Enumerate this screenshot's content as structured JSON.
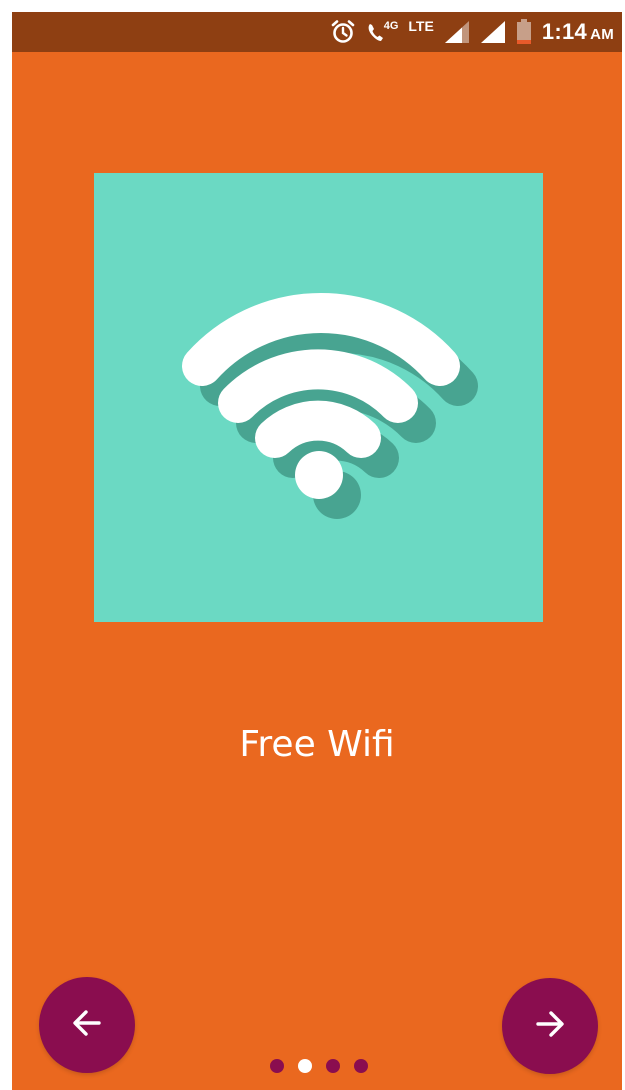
{
  "colors": {
    "status_bar": "#8E3F12",
    "background": "#EA681F",
    "card": "#6BD9C3",
    "wifi_icon": "#FFFFFF",
    "wifi_shadow": "#2D7A6A",
    "nav_button": "#8A0D4F",
    "dot_active": "#FFFFFF",
    "dot_inactive": "#8A0D4F"
  },
  "status_bar": {
    "time": "1:14",
    "ampm": "AM",
    "network": "LTE",
    "call_label": "4G",
    "icons": [
      "alarm-icon",
      "volte-call-icon",
      "signal-icon",
      "signal-icon",
      "battery-icon"
    ]
  },
  "slide": {
    "title": "Free Wifi",
    "image_icon": "wifi-icon"
  },
  "nav": {
    "prev_icon": "arrow-left-icon",
    "next_icon": "arrow-right-icon"
  },
  "pager": {
    "count": 4,
    "active_index": 1
  }
}
